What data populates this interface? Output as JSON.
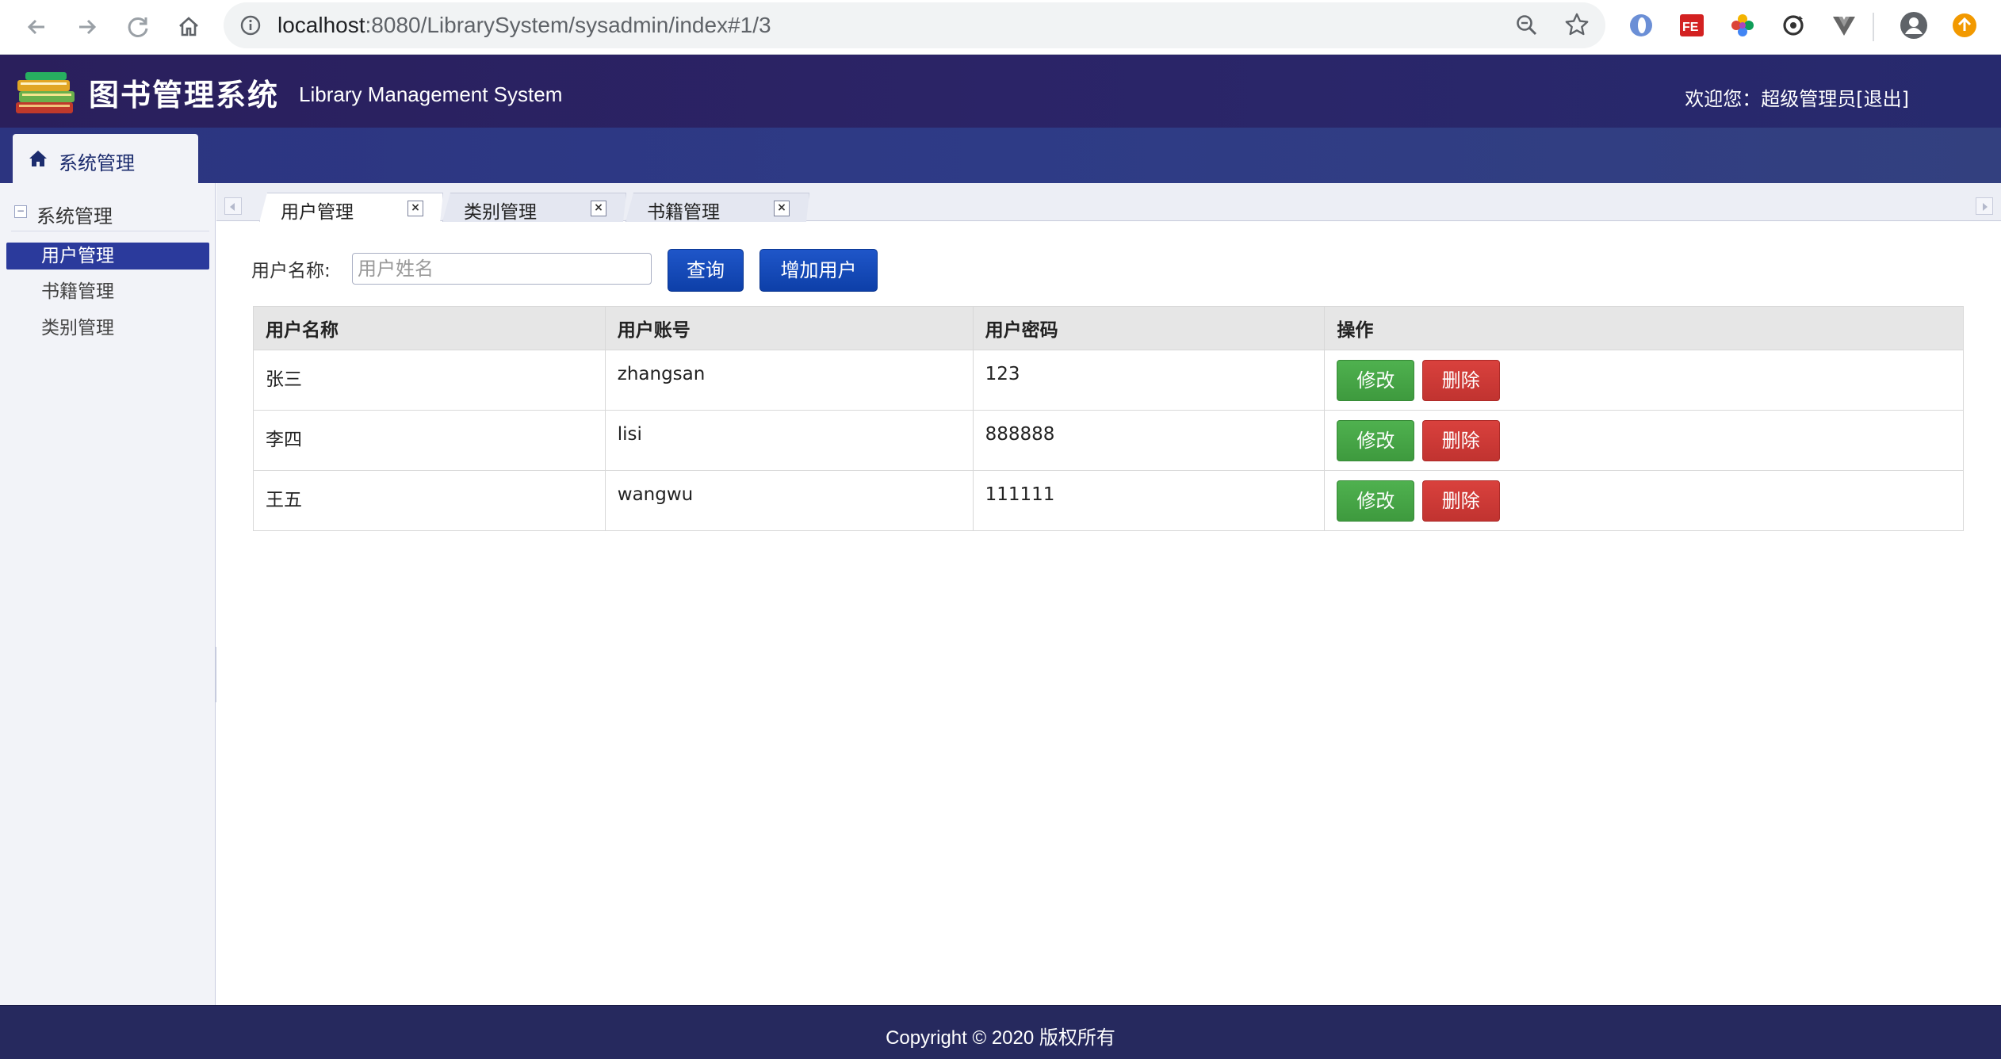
{
  "browser": {
    "url_host": "localhost",
    "url_path": ":8080/LibrarySystem/sysadmin/index#1/3"
  },
  "header": {
    "title_cn": "图书管理系统",
    "title_en": "Library Management System",
    "welcome_prefix": "欢迎您：",
    "user_name": "超级管理员",
    "logout": "[退出]"
  },
  "menu_bar": {
    "tab_label": "系统管理"
  },
  "sidebar": {
    "section_title": "系统管理",
    "items": [
      {
        "label": "用户管理"
      },
      {
        "label": "书籍管理"
      },
      {
        "label": "类别管理"
      }
    ]
  },
  "tabs": [
    {
      "label": "用户管理"
    },
    {
      "label": "类别管理"
    },
    {
      "label": "书籍管理"
    }
  ],
  "search": {
    "label": "用户名称:",
    "placeholder": "用户姓名",
    "value": "",
    "search_button": "查询",
    "add_button": "增加用户"
  },
  "table": {
    "columns": [
      "用户名称",
      "用户账号",
      "用户密码",
      "操作"
    ],
    "rows": [
      {
        "name": "张三",
        "account": "zhangsan",
        "password": "123"
      },
      {
        "name": "李四",
        "account": "lisi",
        "password": "888888"
      },
      {
        "name": "王五",
        "account": "wangwu",
        "password": "111111"
      }
    ],
    "edit_label": "修改",
    "delete_label": "删除"
  },
  "footer": {
    "text": "Copyright © 2020 版权所有"
  },
  "colors": {
    "header_bg": "#2a1f5c",
    "menu_bar_bg": "#2c3480",
    "primary_button": "#0d3fa8",
    "edit_button": "#3e9a3e",
    "delete_button": "#c13330",
    "footer_bg": "#26295e"
  }
}
